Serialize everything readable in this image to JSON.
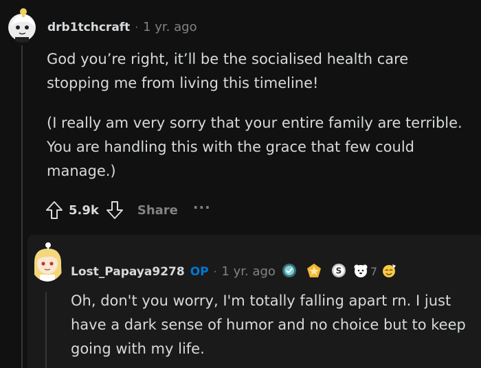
{
  "comment": {
    "username": "drb1tchcraft",
    "separator": "·",
    "time": "1 yr. ago",
    "paragraphs": [
      "God you’re right, it’ll be the socialised health care stopping me from living this timeline!",
      "(I really am very sorry that your entire family are terrible. You are handling this with the grace that few could manage.)"
    ],
    "score": "5.9k",
    "share_label": "Share",
    "more_label": "···"
  },
  "reply": {
    "username": "Lost_Papaya9278",
    "op_badge": "OP",
    "separator": "·",
    "time": "1 yr. ago",
    "awards": [
      "helpful-award-icon",
      "star-award-icon",
      "silver-award-icon",
      "bear-award-icon"
    ],
    "award_count": "7",
    "body": "Oh, don't you worry, I'm totally falling apart rn. I just have a dark sense of humor and no choice but to keep going with my life."
  },
  "colors": {
    "background": "#111111",
    "reply_panel": "#1a1a1a",
    "text": "#d7dadc",
    "muted": "#818384",
    "op_blue": "#0079d3"
  }
}
